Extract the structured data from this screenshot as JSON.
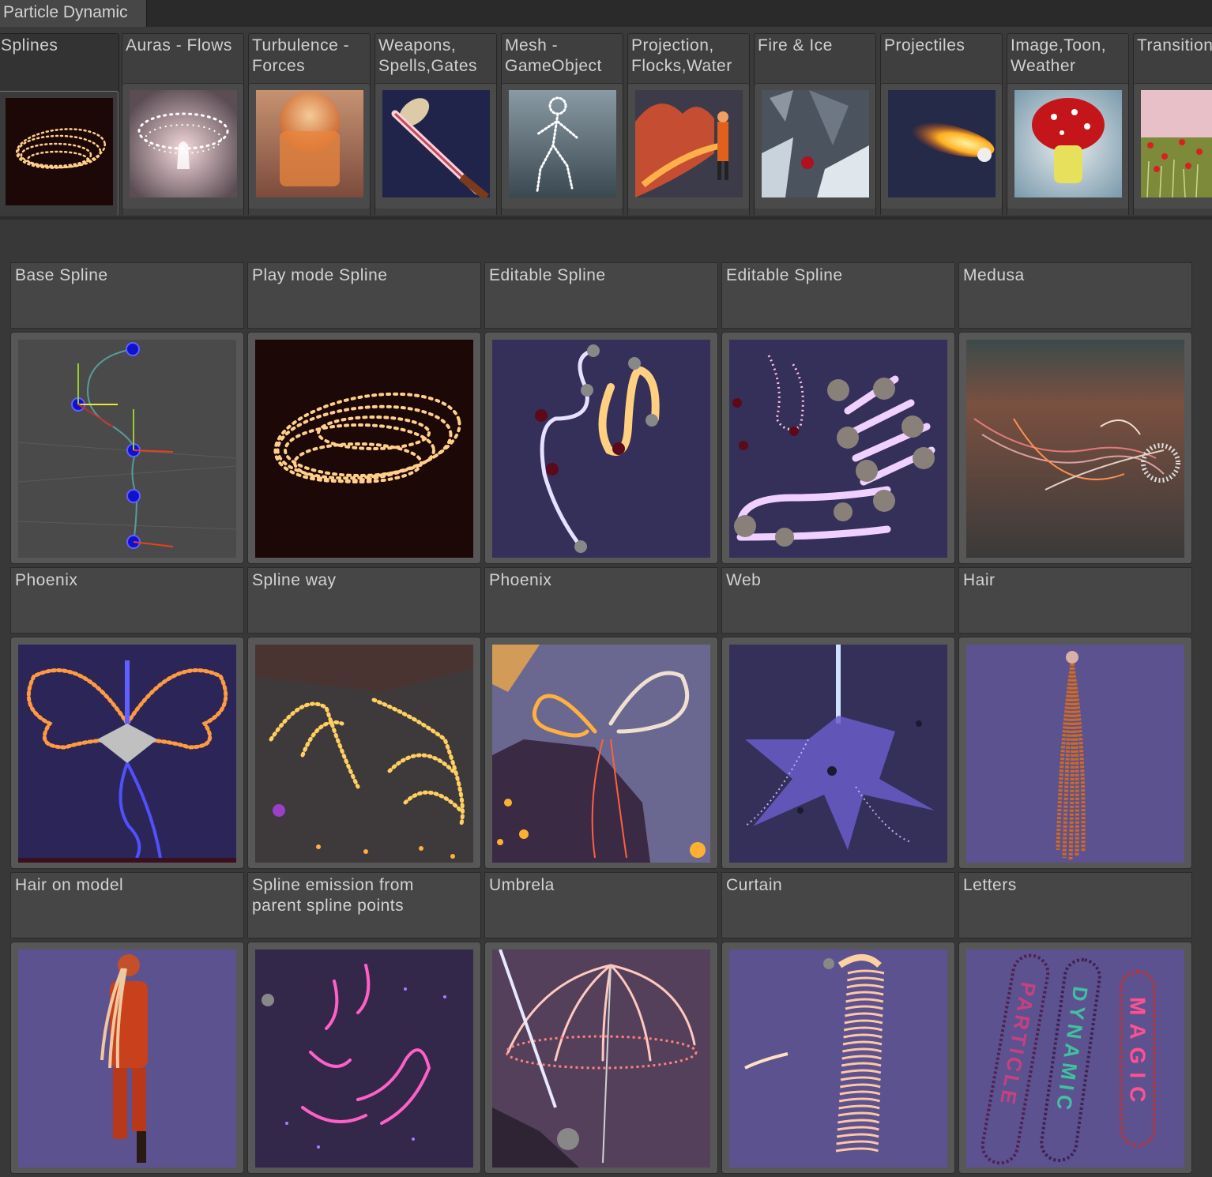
{
  "window": {
    "tab_title": "Particle Dynamic"
  },
  "categories": [
    {
      "label": "Splines",
      "selected": true,
      "thumb": "spline-bowl"
    },
    {
      "label": "Auras - Flows",
      "thumb": "aura-ring"
    },
    {
      "label": "Turbulence -\nForces",
      "thumb": "turbulence-dome"
    },
    {
      "label": "Weapons,\nSpells,Gates",
      "thumb": "glowing-sword"
    },
    {
      "label": "Mesh -\nGameObject",
      "thumb": "particle-figure"
    },
    {
      "label": "Projection,\nFlocks,Water",
      "thumb": "fire-figure"
    },
    {
      "label": "Fire & Ice",
      "thumb": "ice-shards"
    },
    {
      "label": "Projectiles",
      "thumb": "fireball"
    },
    {
      "label": "Image,Toon,\nWeather",
      "thumb": "mushroom"
    },
    {
      "label": "Transitions",
      "thumb": "flower-field"
    }
  ],
  "items": [
    {
      "label": "Base Spline"
    },
    {
      "label": "Play mode Spline"
    },
    {
      "label": "Editable Spline"
    },
    {
      "label": "Editable Spline"
    },
    {
      "label": "Medusa"
    },
    {
      "label": "Phoenix"
    },
    {
      "label": "Spline way"
    },
    {
      "label": "Phoenix"
    },
    {
      "label": "Web"
    },
    {
      "label": "Hair"
    },
    {
      "label": "Hair on model"
    },
    {
      "label": "Spline emission from\nparent spline points"
    },
    {
      "label": "Umbrela"
    },
    {
      "label": "Curtain"
    },
    {
      "label": "Letters"
    }
  ],
  "letters_preview": [
    "PARTICLE",
    "DYNAMIC",
    "MAGIC"
  ]
}
